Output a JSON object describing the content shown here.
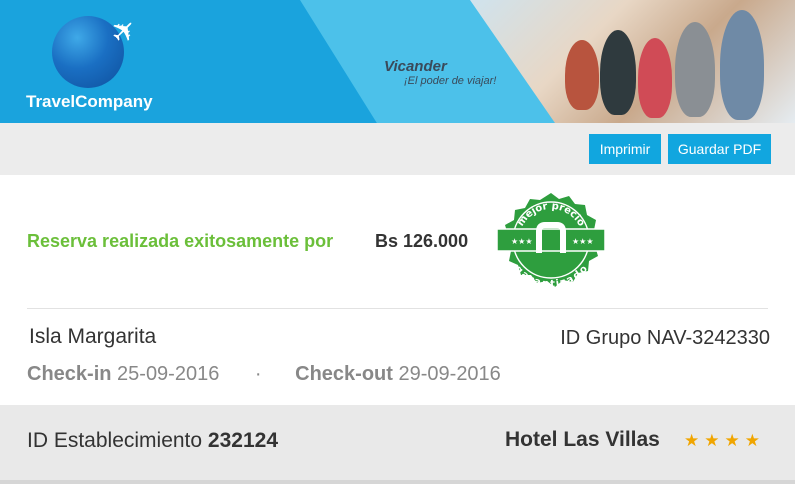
{
  "header": {
    "brand": "TravelCompany",
    "tagline_title": "Vicander",
    "tagline_sub": "¡El poder de viajar!"
  },
  "toolbar": {
    "print_label": "Imprimir",
    "pdf_label": "Guardar PDF"
  },
  "reservation": {
    "success_text": "Reserva realizada exitosamente por",
    "price": "Bs 126.000",
    "badge_top": "mejor precio",
    "badge_bottom": "garantizado"
  },
  "trip": {
    "destination": "Isla Margarita",
    "group_id": "ID Grupo NAV-3242330",
    "checkin_label": "Check-in",
    "checkin_date": "25-09-2016",
    "separator": "·",
    "checkout_label": "Check-out",
    "checkout_date": "29-09-2016"
  },
  "establishment": {
    "label": "ID Establecimiento",
    "id": "232124",
    "hotel_name": "Hotel Las Villas",
    "stars": "★★★★",
    "star_count": 4
  },
  "colors": {
    "brand_blue": "#1aa3dd",
    "button_blue": "#11a6df",
    "success_green": "#6bbf3a",
    "badge_green": "#2e9e3e",
    "star_orange": "#f0a500"
  }
}
